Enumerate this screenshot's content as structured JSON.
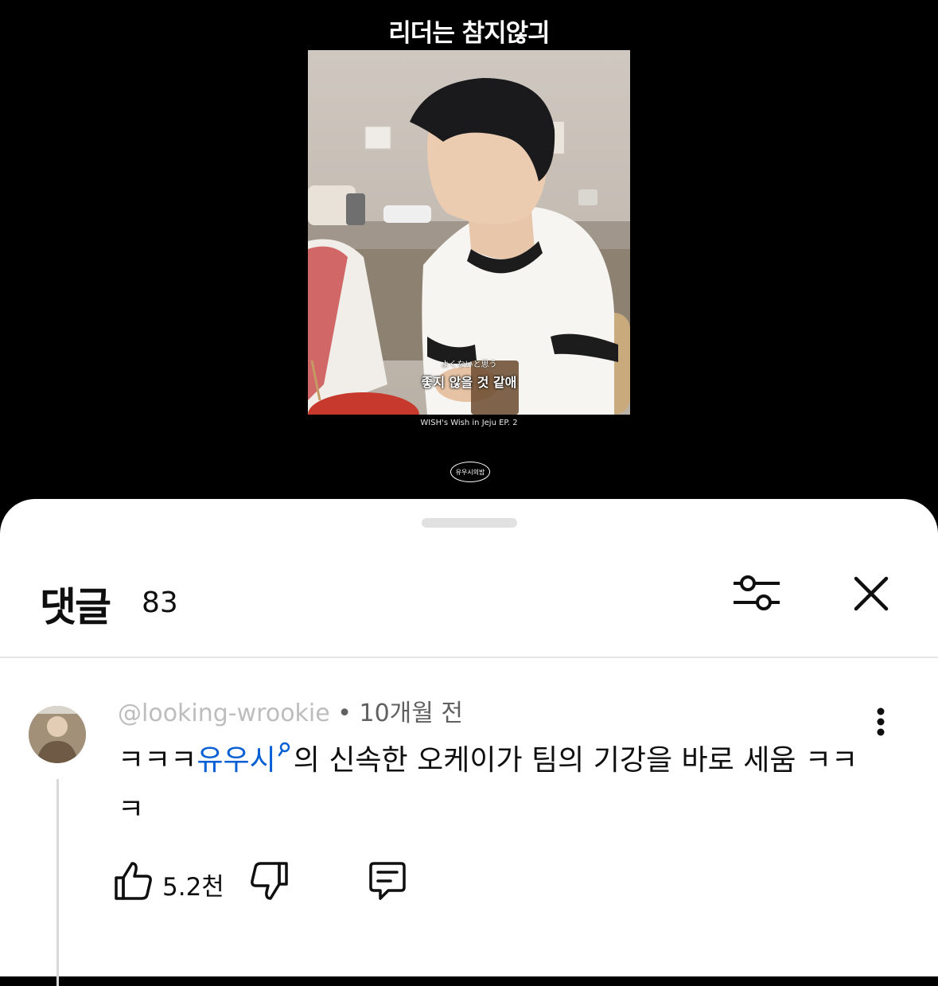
{
  "video": {
    "title": "리더는 참지않긔",
    "subtitle_japanese": "よくないと思う",
    "subtitle_korean": "좋지 않을 것 같애",
    "caption": "WISH's Wish in Jeju EP. 2",
    "channel_logo_text": "유우시의밤"
  },
  "sheet": {
    "title": "댓글",
    "count": "83",
    "filter_icon": "sliders-icon",
    "close_icon": "close-icon"
  },
  "comment": {
    "author": "@looking-wrookie",
    "time": "• 10개월 전",
    "text_before": "ㅋㅋㅋ",
    "mention": "유우시",
    "text_after": "의 신속한 오케이가 팀의 기강을 바로 세움 ㅋㅋㅋ",
    "like_count": "5.2천",
    "like_icon": "thumbs-up-icon",
    "dislike_icon": "thumbs-down-icon",
    "reply_icon": "comment-icon",
    "more_icon": "more-vertical-icon"
  }
}
